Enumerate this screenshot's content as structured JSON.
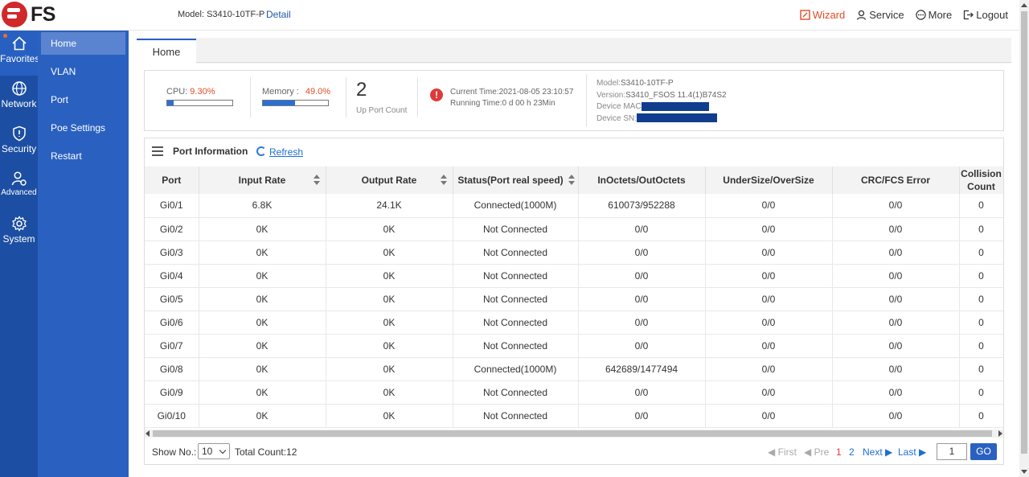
{
  "header": {
    "model_label": "Model: S3410-10TF-P",
    "detail_link": "Detail",
    "actions": {
      "wizard": "Wizard",
      "service": "Service",
      "more": "More",
      "logout": "Logout"
    }
  },
  "logo": {
    "text": "FS"
  },
  "nav_primary": [
    {
      "label": "Favorites",
      "icon": "home-icon"
    },
    {
      "label": "Network",
      "icon": "globe-icon"
    },
    {
      "label": "Security",
      "icon": "shield-icon"
    },
    {
      "label": "Advanced",
      "icon": "user-gear-icon"
    },
    {
      "label": "System",
      "icon": "gear-icon"
    }
  ],
  "nav_secondary": [
    "Home",
    "VLAN",
    "Port",
    "Poe Settings",
    "Restart"
  ],
  "tab": {
    "label": "Home"
  },
  "summary": {
    "cpu_label": "CPU:",
    "cpu_value": "9.30%",
    "cpu_percent": 9.3,
    "memory_label": "Memory :",
    "memory_value": "49.0%",
    "memory_percent": 49.0,
    "up_port_count": "2",
    "up_port_label": "Up Port Count",
    "current_time": "Current Time:2021-08-05 23:10:57",
    "running_time": "Running Time:0 d 00 h 23Min",
    "model_key": "Model:",
    "model_value": "S3410-10TF-P",
    "version_key": "Version:",
    "version_value": "S3410_FSOS 11.4(1)B74S2",
    "device_mac_key": "Device MAC",
    "device_sn_key": "Device SN:"
  },
  "port_info": {
    "title": "Port Information",
    "refresh": "Refresh",
    "columns": [
      "Port",
      "Input Rate",
      "Output Rate",
      "Status(Port real speed)",
      "InOctets/OutOctets",
      "UnderSize/OverSize",
      "CRC/FCS Error",
      "Collision Count"
    ],
    "rows": [
      [
        "Gi0/1",
        "6.8K",
        "24.1K",
        "Connected(1000M)",
        "610073/952288",
        "0/0",
        "0/0",
        "0"
      ],
      [
        "Gi0/2",
        "0K",
        "0K",
        "Not Connected",
        "0/0",
        "0/0",
        "0/0",
        "0"
      ],
      [
        "Gi0/3",
        "0K",
        "0K",
        "Not Connected",
        "0/0",
        "0/0",
        "0/0",
        "0"
      ],
      [
        "Gi0/4",
        "0K",
        "0K",
        "Not Connected",
        "0/0",
        "0/0",
        "0/0",
        "0"
      ],
      [
        "Gi0/5",
        "0K",
        "0K",
        "Not Connected",
        "0/0",
        "0/0",
        "0/0",
        "0"
      ],
      [
        "Gi0/6",
        "0K",
        "0K",
        "Not Connected",
        "0/0",
        "0/0",
        "0/0",
        "0"
      ],
      [
        "Gi0/7",
        "0K",
        "0K",
        "Not Connected",
        "0/0",
        "0/0",
        "0/0",
        "0"
      ],
      [
        "Gi0/8",
        "0K",
        "0K",
        "Connected(1000M)",
        "642689/1477494",
        "0/0",
        "0/0",
        "0"
      ],
      [
        "Gi0/9",
        "0K",
        "0K",
        "Not Connected",
        "0/0",
        "0/0",
        "0/0",
        "0"
      ],
      [
        "Gi0/10",
        "0K",
        "0K",
        "Not Connected",
        "0/0",
        "0/0",
        "0/0",
        "0"
      ]
    ]
  },
  "pager": {
    "show_label": "Show No.:",
    "show_value": "10",
    "total": "Total Count:12",
    "first": "First",
    "prev": "Pre",
    "page1": "1",
    "page2": "2",
    "next": "Next",
    "last": "Last",
    "page_input": "1",
    "go": "GO"
  }
}
